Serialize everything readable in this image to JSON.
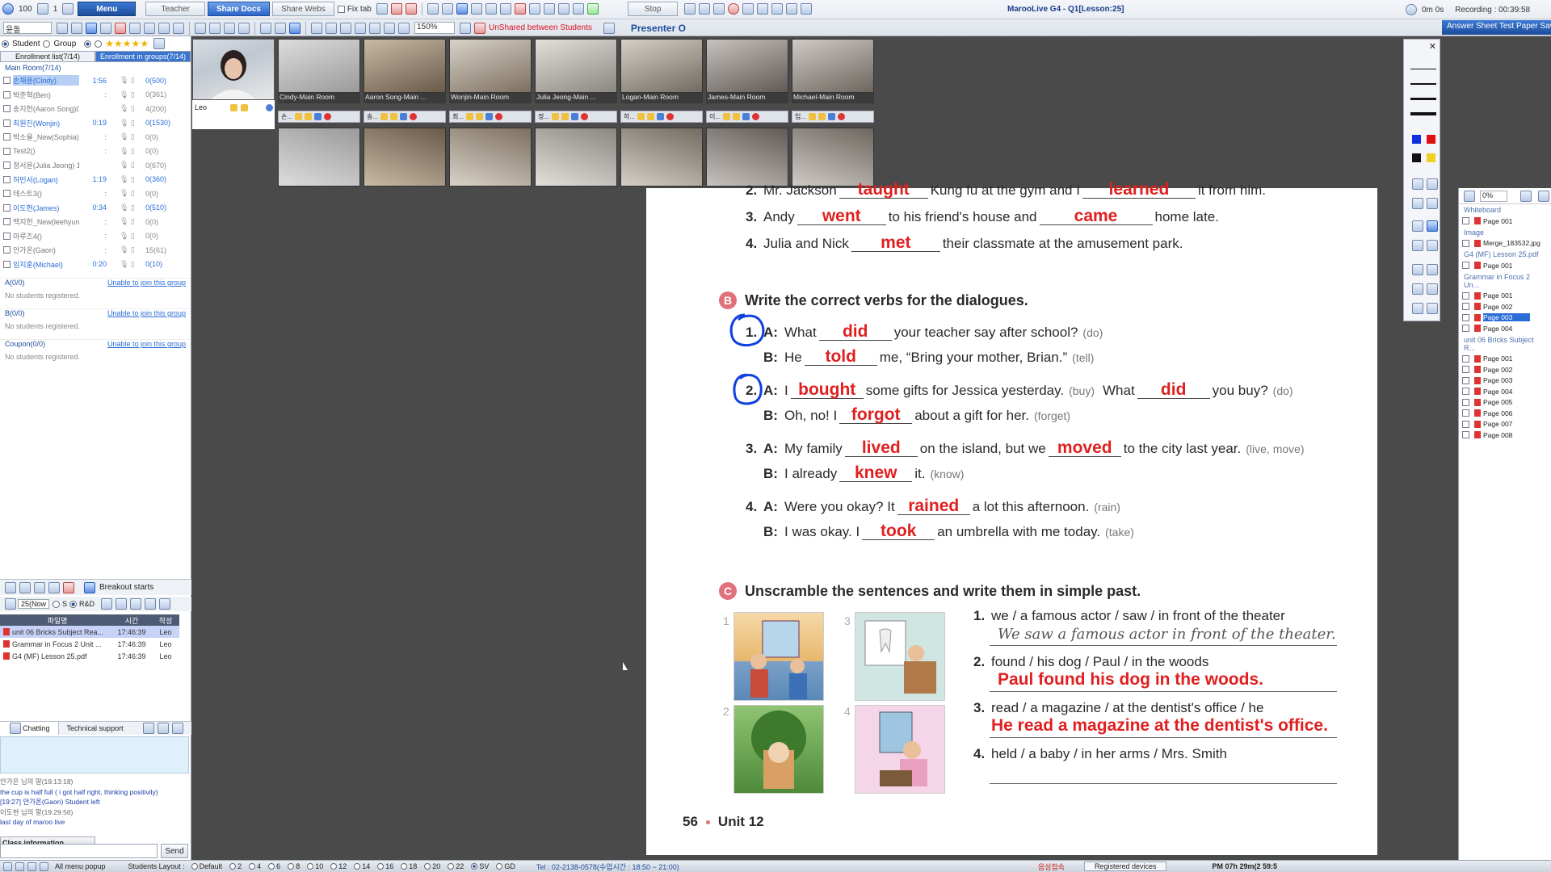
{
  "toolbar": {
    "zoom_level": "100",
    "volume": "1",
    "menu_label": "Menu",
    "tabs": [
      "Teacher",
      "Share Docs",
      "Share Webs"
    ],
    "fix_tab": "Fix tab",
    "stop_label": "Stop",
    "window_title": "MarooLive G4 - Q1[Lesson:25]",
    "timer": "0m 0s",
    "recording": "Recording : 00:39:58",
    "answer_sheet": "Answer Sheet Test Paper Sav",
    "zoom_select": "150%",
    "unshared": "UnShared between Students",
    "presenter": "Presenter O",
    "lang_select": "윤돌"
  },
  "left_panel": {
    "radio_student": "Student",
    "radio_group": "Group",
    "tab_enrollment": "Enrollment list(7/14)",
    "tab_groups": "Enrollment in groups(7/14)",
    "main_room": "Main Room(7/14)",
    "students": [
      {
        "name": "손채윤(Cindy)",
        "time": "1:56",
        "score": "0(500)"
      },
      {
        "name": "박준혁(Ben)",
        "time": ":",
        "score": "0(361)"
      },
      {
        "name": "송지헌(Aaron Song)0:50",
        "time": "",
        "score": "4(200)"
      },
      {
        "name": "최원진(Wonjin)",
        "time": "0:19",
        "score": "0(1530)"
      },
      {
        "name": "박소율_New(Sophia)",
        "time": ":",
        "score": "0(0)"
      },
      {
        "name": "Test2()",
        "time": ":",
        "score": "0(0)"
      },
      {
        "name": "정서윤(Julia Jeong) 1:1",
        "time": "",
        "score": "0(670)"
      },
      {
        "name": "하민서(Logan)",
        "time": "1:19",
        "score": "0(360)"
      },
      {
        "name": "테스트3()",
        "time": ":",
        "score": "0(0)"
      },
      {
        "name": "이도현(James)",
        "time": "0:34",
        "score": "0(510)"
      },
      {
        "name": "백지헌_New(leehyun)",
        "time": ":",
        "score": "0(0)"
      },
      {
        "name": "마루즈4()",
        "time": ":",
        "score": "0(0)"
      },
      {
        "name": "안가온(Gaon)",
        "time": ":",
        "score": "15(61)"
      },
      {
        "name": "임지훈(Michael)",
        "time": "0:20",
        "score": "0(10)"
      }
    ],
    "groups": [
      {
        "name": "A(0/0)",
        "link": "Unable to join this group",
        "empty": "No students registered."
      },
      {
        "name": "B(0/0)",
        "link": "Unable to join this group",
        "empty": "No students registered."
      },
      {
        "name": "Coupon(0/0)",
        "link": "Unable to join this group",
        "empty": "No students registered."
      }
    ],
    "breakout_label": "Breakout starts",
    "file_filter": "25(Now",
    "file_radio_s": "S",
    "file_radio_rb": "R&D",
    "file_headers": [
      "파일명",
      "시간",
      "작성"
    ],
    "files": [
      {
        "name": "unit 06 Bricks Subject Rea...",
        "time": "17:46:39",
        "author": "Leo"
      },
      {
        "name": "Grammar in Focus 2 Unit ...",
        "time": "17:46:39",
        "author": "Leo"
      },
      {
        "name": "G4 (MF) Lesson 25.pdf",
        "time": "17:46:39",
        "author": "Leo"
      }
    ],
    "chat_tab": "Chatting",
    "support_tab": "Technical support",
    "chat_log": [
      {
        "type": "sys",
        "text": "안가은 님의 말(19:13:18)"
      },
      {
        "type": "msg",
        "text": "the cup is half full ( i got half right, thinking positivily)"
      },
      {
        "type": "msg",
        "text": "[19:27] 안가온(Gaon) Student left"
      },
      {
        "type": "sys",
        "text": "이도현 님의 말(19:29:56)"
      },
      {
        "type": "msg",
        "text": "last day of maroo live"
      }
    ],
    "class_info": "Class information",
    "send_label": "Send"
  },
  "videos": {
    "teacher_name": "Leo",
    "top_labels": [
      "Cindy-Main Room",
      "Aaron Song-Main ...",
      "Wonjin-Main Room",
      "Julia Jeong-Main ...",
      "Logan-Main Room",
      "James-Main Room",
      "Michael-Main Room"
    ],
    "ctrl_labels": [
      "손...",
      "송...",
      "최...",
      "정...",
      "하...",
      "이...",
      "임..."
    ]
  },
  "worksheet": {
    "a_lines": [
      {
        "num": "2.",
        "pre": "Mr. Jackson",
        "ans1": "taught",
        "mid": "Kung fu at the gym and I",
        "ans2": "learned",
        "post": "it from him."
      },
      {
        "num": "3.",
        "pre": "Andy",
        "ans1": "went",
        "mid": "to his friend's house and",
        "ans2": "came",
        "post": "home late."
      },
      {
        "num": "4.",
        "pre": "Julia and Nick",
        "ans1": "met",
        "mid": "their classmate at the amusement park.",
        "ans2": "",
        "post": ""
      }
    ],
    "section_b": {
      "badge": "B",
      "title": "Write the correct verbs for the dialogues."
    },
    "b_items": [
      {
        "num": "1.",
        "a_pre": "What",
        "a_ans": "did",
        "a_post": "your teacher say after school?",
        "a_hint": "(do)",
        "b_pre": "He",
        "b_ans": "told",
        "b_post": "me, “Bring your mother, Brian.”",
        "b_hint": "(tell)"
      },
      {
        "num": "2.",
        "a_pre": "I",
        "a_ans": "bought",
        "a_post": "some gifts for Jessica yesterday.",
        "a_hint": "(buy)",
        "a_extra": "What",
        "a_ans2": "did",
        "a_post2": "you buy?",
        "a_hint2": "(do)",
        "b_pre": "Oh, no! I",
        "b_ans": "forgot",
        "b_post": "about a gift for her.",
        "b_hint": "(forget)"
      },
      {
        "num": "3.",
        "a_pre": "My family",
        "a_ans": "lived",
        "a_post": "on the island, but we",
        "a_ans2": "moved",
        "a_post2": "to the city last year.",
        "a_hint2": "(live, move)",
        "b_pre": "I already",
        "b_ans": "knew",
        "b_post": "it.",
        "b_hint": "(know)"
      },
      {
        "num": "4.",
        "a_pre": "Were you okay? It",
        "a_ans": "rained",
        "a_post": "a lot this afternoon.",
        "a_hint": "(rain)",
        "b_pre": "I was okay. I",
        "b_ans": "took",
        "b_post": "an umbrella with me today.",
        "b_hint": "(take)"
      }
    ],
    "speaker_a": "A:",
    "speaker_b": "B:",
    "section_c": {
      "badge": "C",
      "title": "Unscramble the sentences and write them in simple past."
    },
    "c_items": [
      {
        "num": "1.",
        "prompt": "we / a famous actor / saw / in front of the theater",
        "answer": "We saw a famous actor in front of the theater.",
        "style": "hand"
      },
      {
        "num": "2.",
        "prompt": "found / his dog / Paul / in the woods",
        "answer": "Paul found his dog in the woods.",
        "style": "red"
      },
      {
        "num": "3.",
        "prompt": "read / a magazine / at the dentist's office / he",
        "answer": "He read a magazine at the dentist's office.",
        "style": "red"
      },
      {
        "num": "4.",
        "prompt": "held / a baby / in her arms / Mrs. Smith",
        "answer": "",
        "style": "none"
      }
    ],
    "pic_numbers": [
      "1",
      "2",
      "3",
      "4"
    ],
    "page_number": "56",
    "unit_label": "Unit 12"
  },
  "right_panel": {
    "zoom": "0%",
    "groups": [
      {
        "name": "Whiteboard",
        "items": [
          "Page 001"
        ]
      },
      {
        "name": "Image",
        "items": [
          "Merge_183532.jpg"
        ]
      },
      {
        "name": "G4 (MF) Lesson 25.pdf",
        "items": [
          "Page 001"
        ]
      },
      {
        "name": "Grammar in Focus 2 Un...",
        "items": [
          "Page 001",
          "Page 002",
          "Page 003",
          "Page 004"
        ]
      },
      {
        "name": "unit 06 Bricks Subject R...",
        "items": [
          "Page 001",
          "Page 002",
          "Page 003",
          "Page 004",
          "Page 005",
          "Page 006",
          "Page 007",
          "Page 008"
        ]
      }
    ],
    "selected": "Grammar in Focus 2 Un.../Page 003"
  },
  "statusbar": {
    "menu_popup": "All menu popup",
    "layout_label": "Students Layout :",
    "layouts": [
      "Default",
      "2",
      "4",
      "6",
      "8",
      "10",
      "12",
      "14",
      "16",
      "18",
      "20",
      "22",
      "SV",
      "GD"
    ],
    "tel": "Tel : 02-2138-0578(수업시간 : 18:50 ~ 21:00)",
    "connect": "음성접속",
    "registered": "Registered devices",
    "clock": "PM 07h 29m(2 59:5"
  },
  "colors": {
    "accent": "#2c66c8",
    "answer_red": "#e02020",
    "badge": "#e0707a",
    "pen_blue": "#1040e0"
  }
}
